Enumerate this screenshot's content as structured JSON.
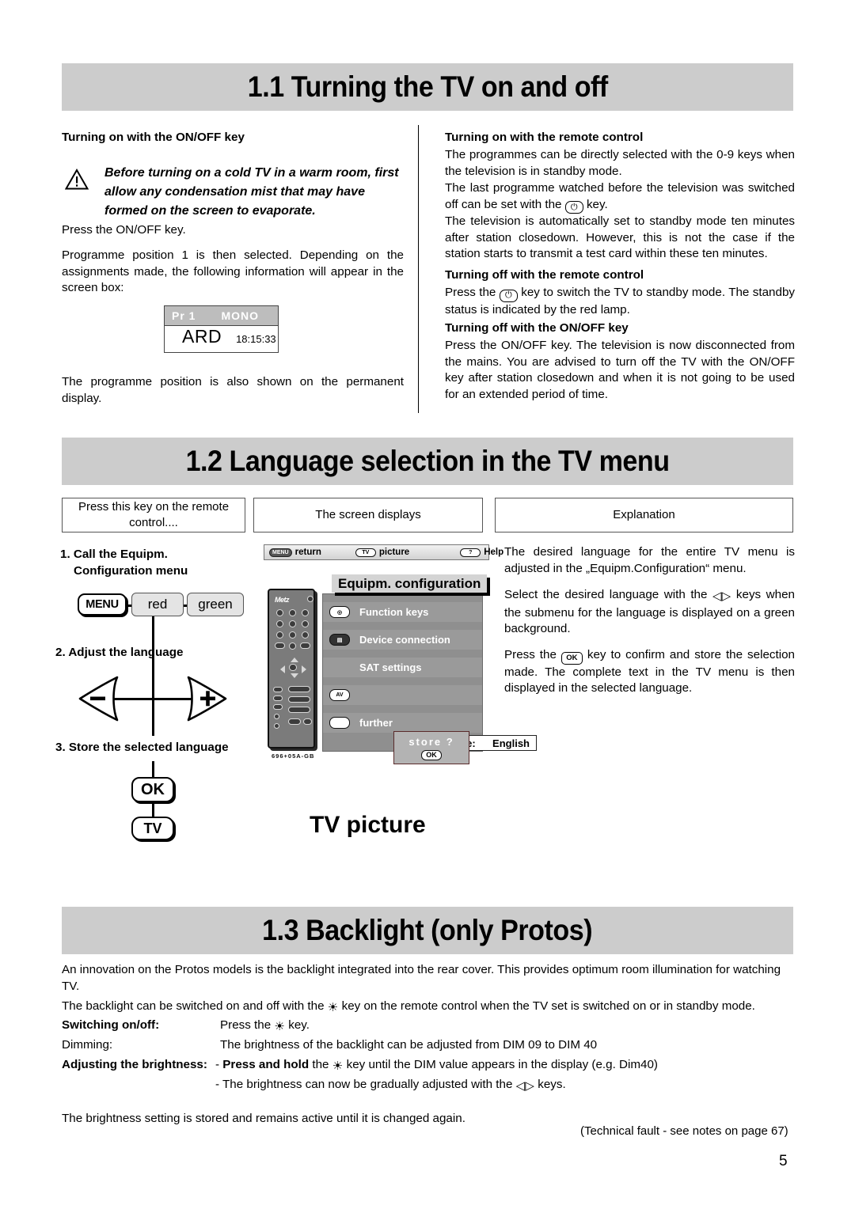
{
  "sections": {
    "s11": {
      "title": "1.1 Turning the TV on and off",
      "left": {
        "heading": "Turning on with the ON/OFF key",
        "warning": "Before turning on a cold TV in a warm room, first allow any condensation mist that may have formed on the screen to evaporate.",
        "p1": "Press the ON/OFF key.",
        "p2": "Programme position 1 is then selected. Depending on the assignments made, the following information will appear in the screen box:",
        "screenbox": {
          "pr": "Pr 1",
          "mono": "MONO",
          "channel": "ARD",
          "time": "18:15:33"
        },
        "p3": "The programme position is also shown on the permanent display."
      },
      "right": {
        "h1": "Turning on with the remote control",
        "p1": "The programmes can be directly selected with the 0-9 keys when the television is in standby mode.",
        "p2a": "The last programme watched before the television was switched off can be set with the",
        "p2b": "key.",
        "p3": "The television is automatically set to standby mode ten minutes after station closedown. However, this is not the case if the station starts to transmit a test card within these ten minutes.",
        "h2": "Turning off with the remote control",
        "p4a": "Press the",
        "p4b": "key to switch the TV to standby mode. The standby status is indicated by the red lamp.",
        "h3": "Turning off with the ON/OFF key",
        "p5": "Press the ON/OFF key. The television is now disconnected from the mains. You are advised to turn off the TV with the ON/OFF key after station closedown and when it is not going to be used for an extended period of time."
      }
    },
    "s12": {
      "title": "1.2 Language selection in the TV menu",
      "col_headers": [
        "Press this key on the remote control....",
        "The screen displays",
        "Explanation"
      ],
      "steps": {
        "step1_line1": "1. Call the Equipm.",
        "step1_line2": "Configuration menu",
        "step2": "2. Adjust the language",
        "step3": "3. Store the selected language"
      },
      "keys": {
        "menu": "MENU",
        "red": "red",
        "green": "green",
        "minus": "–",
        "plus": "+",
        "ok": "OK",
        "tv": "TV"
      },
      "tv_screen": {
        "menubar": [
          {
            "badge": "MENU",
            "label": "return"
          },
          {
            "badge": "TV",
            "label": "picture"
          },
          {
            "badge": "?",
            "label": "Help"
          }
        ],
        "panel_title": "Equipm. configuration",
        "rows": [
          {
            "icon": "function-keys-icon",
            "label": "Function keys"
          },
          {
            "icon": "device-connection-icon",
            "label": "Device connection"
          },
          {
            "icon": "",
            "label": "SAT settings"
          },
          {
            "icon": "AV",
            "label": "Language:",
            "value": "English"
          },
          {
            "icon": "blank-key-icon",
            "label": "further"
          }
        ],
        "store": {
          "text": "store ?",
          "ok": "OK"
        },
        "remote_logo": "Metz",
        "remote_code": "696+05A-GB"
      },
      "caption": "TV picture",
      "explanation": {
        "p1": "The desired language for the entire TV menu is adjusted in the „Equipm.Configuration“ menu.",
        "p2a": "Select the desired language with the",
        "p2b": "keys when the submenu for the language is displayed on a green background.",
        "p3a": "Press the",
        "p3b": "key to confirm and store the selection made. The complete text in the TV menu is then displayed in the selected language."
      }
    },
    "s13": {
      "title": "1.3 Backlight (only Protos)",
      "p1": "An innovation on the Protos models is the backlight integrated into the rear cover. This provides optimum room illumination for watching TV.",
      "p2a": "The backlight can be switched on and off with the",
      "p2b": "key on the remote control when the TV set is switched on or in standby mode.",
      "rows": [
        {
          "label": "Switching on/off:",
          "bold_label": true,
          "text_a": "Press the",
          "text_b": "key."
        },
        {
          "label": "Dimming:",
          "bold_label": false,
          "text": "The brightness of the backlight can be adjusted from DIM 09 to DIM 40"
        },
        {
          "label": "Adjusting the brightness:",
          "bold_label": true,
          "lead": "- ",
          "strong": "Press and hold",
          "text_a": "the",
          "text_b": "key until the DIM value appears in the display (e.g. Dim40)"
        }
      ],
      "last_bullet_a": "- The brightness can now be gradually adjusted with the",
      "last_bullet_b": "keys.",
      "closing": "The brightness setting is stored and remains active until it is changed again."
    },
    "footer": {
      "note": "(Technical fault - see notes on page 67)",
      "page": "5"
    }
  },
  "colors": {
    "header_bar": "#cccccc",
    "menu_panel": "#8f8f8f",
    "menu_row": "#9a9a9a",
    "key_fill": "#e4e4e4"
  }
}
